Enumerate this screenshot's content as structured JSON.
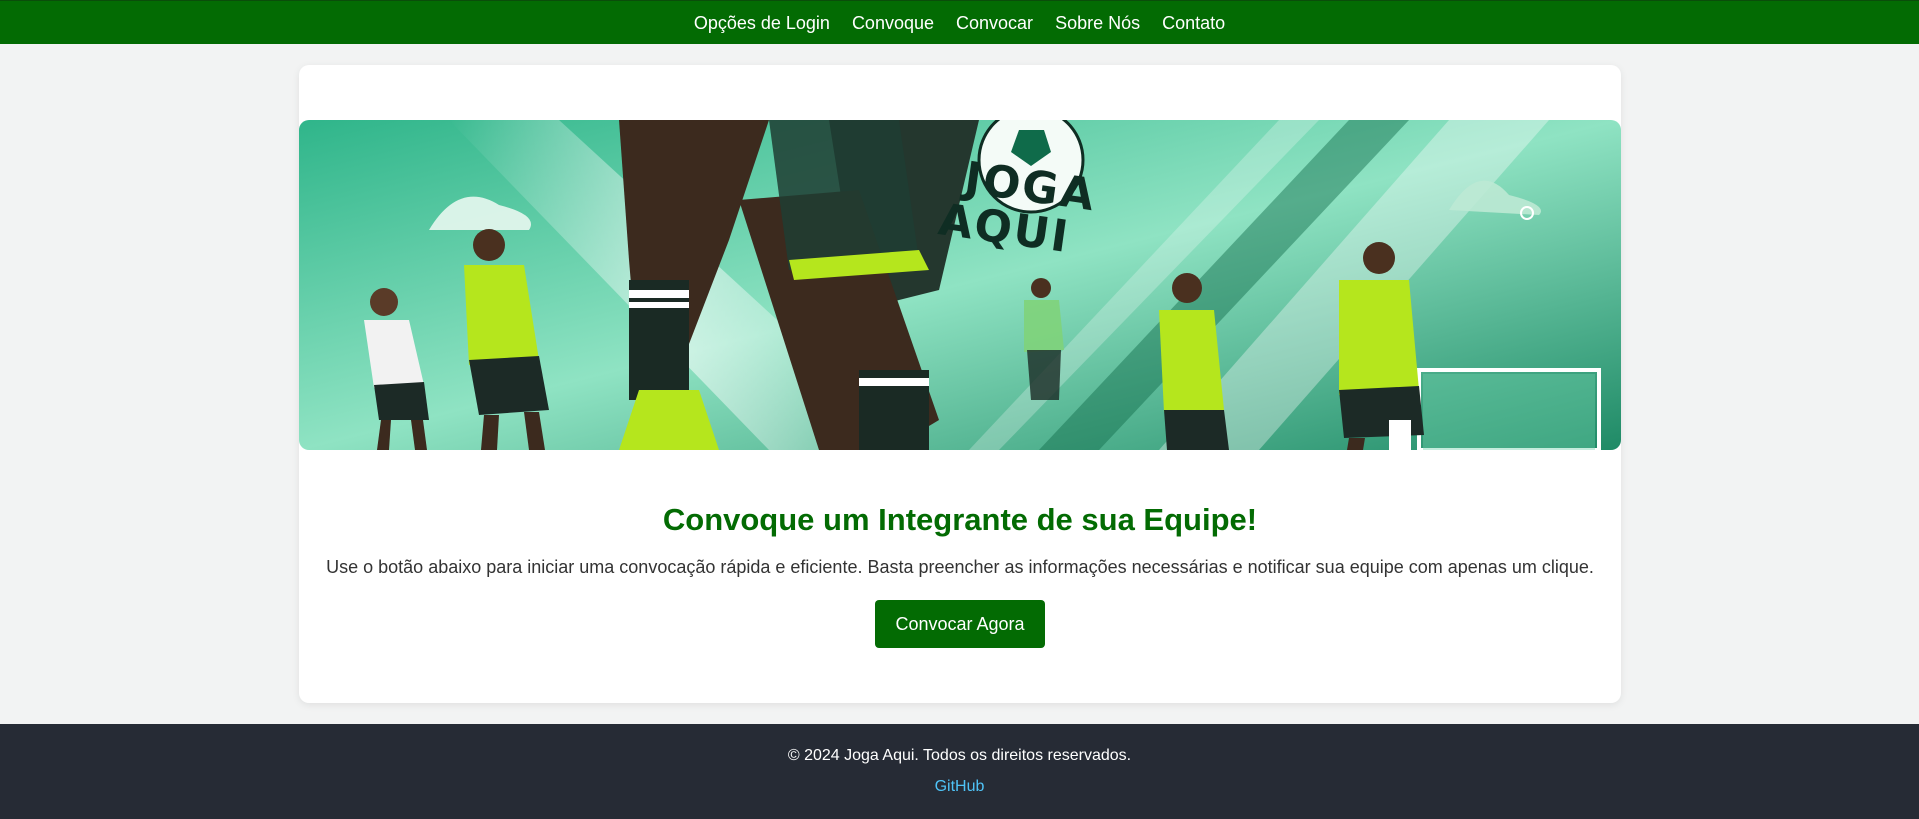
{
  "nav": {
    "items": [
      {
        "label": "Opções de Login"
      },
      {
        "label": "Convoque"
      },
      {
        "label": "Convocar"
      },
      {
        "label": "Sobre Nós"
      },
      {
        "label": "Contato"
      }
    ]
  },
  "banner": {
    "brand_line1": "JOGA",
    "brand_line2": "AQUI"
  },
  "main": {
    "heading": "Convoque um Integrante de sua Equipe!",
    "description": "Use o botão abaixo para iniciar uma convocação rápida e eficiente. Basta preencher as informações necessárias e notificar sua equipe com apenas um clique.",
    "button_label": "Convocar Agora"
  },
  "footer": {
    "copyright": "© 2024 Joga Aqui. Todos os direitos reservados.",
    "link_label": "GitHub"
  },
  "colors": {
    "primary_green": "#036b03",
    "footer_bg": "#262b35",
    "link": "#4fc3f7",
    "page_bg": "#f2f3f3"
  }
}
